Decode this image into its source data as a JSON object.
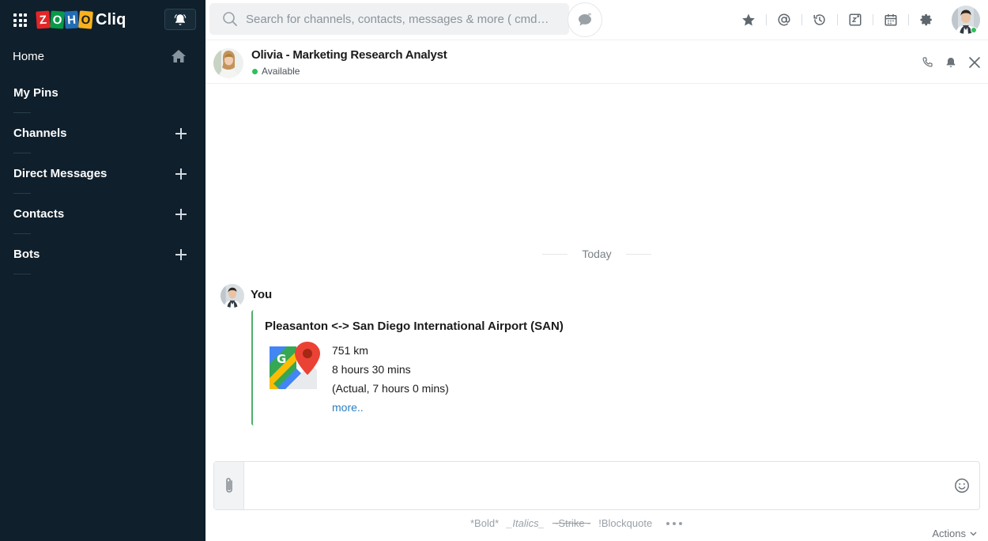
{
  "app": {
    "logo_letters": [
      "Z",
      "O",
      "H",
      "O"
    ],
    "logo_product": "Cliq"
  },
  "sidebar": {
    "items": [
      {
        "label": "Home",
        "icon": "home-icon"
      },
      {
        "label": "My Pins"
      },
      {
        "label": "Channels",
        "icon": "plus-icon"
      },
      {
        "label": "Direct Messages",
        "icon": "plus-icon"
      },
      {
        "label": "Contacts",
        "icon": "plus-icon"
      },
      {
        "label": "Bots",
        "icon": "plus-icon"
      }
    ]
  },
  "search": {
    "placeholder": "Search for channels, contacts, messages & more  ( cmd + k )"
  },
  "topbar": {
    "icons": [
      "star-icon",
      "mention-icon",
      "history-icon",
      "zoho-apps-icon",
      "calendar-icon",
      "gear-icon"
    ]
  },
  "chat": {
    "contact_name": "Olivia - Marketing Research Analyst",
    "contact_status": "Available",
    "day_separator": "Today",
    "message": {
      "sender": "You",
      "card_title": "Pleasanton <-> San Diego International Airport (SAN)",
      "distance": "751 km",
      "duration": "8 hours 30 mins",
      "actual": "(Actual, 7 hours 0 mins)",
      "more_link": "more.."
    }
  },
  "composer": {
    "actions_label": "Actions",
    "hints": {
      "bold": "*Bold*",
      "italic": "_Italics_",
      "strike": "~Strike~",
      "blockquote": "!Blockquote"
    }
  },
  "colors": {
    "sidebar_bg": "#0f1f2b",
    "accent_green": "#4caf6a",
    "link_blue": "#2b7ec1",
    "online_green": "#2fbf5b"
  }
}
